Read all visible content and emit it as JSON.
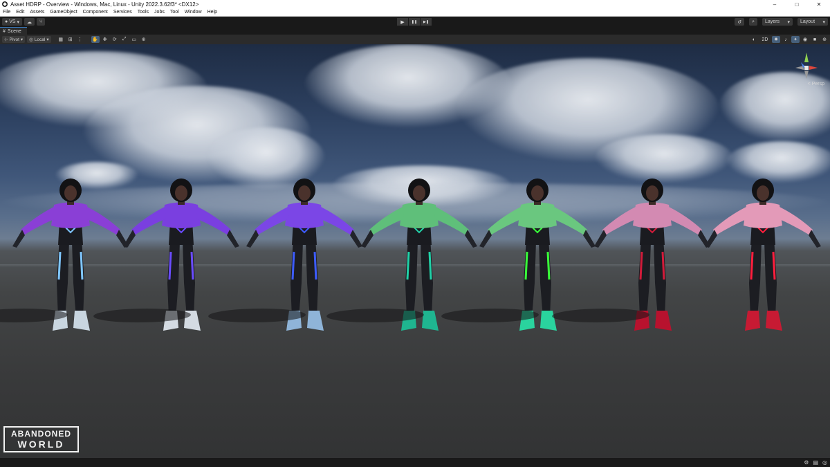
{
  "window": {
    "title": "Asset HDRP - Overview - Windows, Mac, Linux - Unity 2022.3.62f3* <DX12>",
    "controls": [
      "–",
      "□",
      "✕"
    ]
  },
  "menu": [
    "File",
    "Edit",
    "Assets",
    "GameObject",
    "Component",
    "Services",
    "Tools",
    "Jobs",
    "Tool",
    "Window",
    "Help"
  ],
  "toolbar": {
    "account_label": "VS",
    "play_glyph": "▶",
    "pause_glyph": "❚❚",
    "step_glyph": "▶❚",
    "layers_label": "Layers",
    "layout_label": "Layout"
  },
  "scene_tab": {
    "label": "Scene"
  },
  "scene_toolbar": {
    "pivot_label": "Pivot",
    "local_label": "Local",
    "mode_2d": "2D"
  },
  "viewport": {
    "projection_label": "< Persp"
  },
  "watermark": {
    "line1": "ABANDONED",
    "line2": "WORLD"
  },
  "characters": [
    {
      "sweater": "#8a3fd6",
      "accent": "#7fc6ff",
      "boots": "#c9d6e0"
    },
    {
      "sweater": "#7a3fe0",
      "accent": "#6a4cff",
      "boots": "#d4dbe2"
    },
    {
      "sweater": "#7b46e6",
      "accent": "#3d5cff",
      "boots": "#8fb4d8"
    },
    {
      "sweater": "#5fbf7a",
      "accent": "#21d2a8",
      "boots": "#1fb590"
    },
    {
      "sweater": "#6ac77f",
      "accent": "#39ff3a",
      "boots": "#2ad39e"
    },
    {
      "sweater": "#d38ab2",
      "accent": "#d21b3a",
      "boots": "#b8122e"
    },
    {
      "sweater": "#e39ab8",
      "accent": "#ff1e3d",
      "boots": "#c71a33"
    }
  ]
}
